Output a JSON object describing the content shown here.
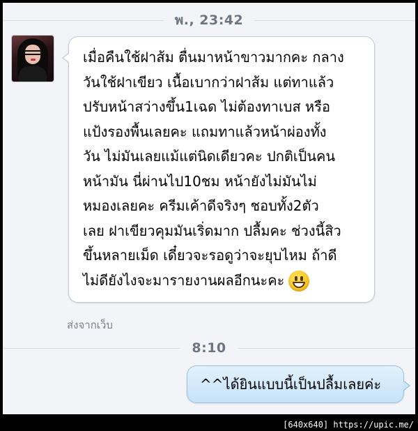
{
  "conversation": {
    "timestamp_1": "พ., 23:42",
    "timestamp_2": "8:10"
  },
  "incoming_message": {
    "lines": [
      "เมื่อคืนใช้ฝาส้ม ตื่นมาหน้าขาวมากคะ กลาง",
      "วันใช้ฝาเขียว เนื้อเบากว่าฝาส้ม แต่ทาแล้ว",
      "ปรับหน้าสว่างขึ้น1เฉด ไม่ต้องทาเบส หรือ",
      "แป้งรองพื้นเลยคะ แถมทาแล้วหน้าผ่องทั้ง",
      "วัน ไม่มันเลยแม้แต่นิดเดียวคะ ปกติเป็นคน",
      "หน้ามัน นี่ผ่านไป10ชม หน้ายังไม่มันไม่",
      "หมองเลยคะ ครีมเค้าดีจริงๆ ชอบทั้ง2ตัว",
      "เลย ฝาเขียวคุมมันเริ่ดมาก ปลื้มคะ ช่วงนี้สิว",
      "ขึ้นหลายเม็ด เดี๋ยวจะรอดูว่าจะยุบไหม ถ้าดี",
      "ไม่ดียังไงจะมารายงานผลอีกนะคะ"
    ],
    "emoji_icon": "grinning-face-emoji",
    "sent_from": "ส่งจากเว็บ"
  },
  "outgoing_message": {
    "text": "^^ได้ยินแบบนี้เป็นปลื้มเลยค่ะ"
  },
  "watermark": "[640x640] https://upic.me/",
  "colors": {
    "background": "#f2f4f7",
    "incoming_bubble": "#ffffff",
    "outgoing_bubble": "#cfe6f9",
    "timestamp_text": "#6e7580"
  }
}
